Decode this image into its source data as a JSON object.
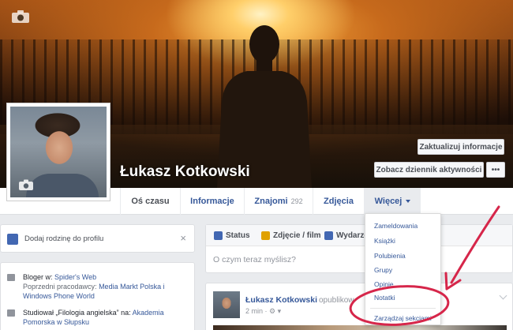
{
  "profile": {
    "name": "Łukasz Kotkowski",
    "update_info_label": "Zaktualizuj informacje",
    "activity_log_label": "Zobacz dziennik aktywności",
    "more_label": "•••"
  },
  "nav": {
    "tabs": [
      {
        "label": "Oś czasu",
        "active": true
      },
      {
        "label": "Informacje"
      },
      {
        "label": "Znajomi",
        "count": "292"
      },
      {
        "label": "Zdjęcia"
      },
      {
        "label": "Więcej"
      }
    ]
  },
  "dropdown": {
    "items": [
      "Zameldowania",
      "Książki",
      "Polubienia",
      "Grupy",
      "Opinie",
      "Notatki"
    ],
    "manage_label": "Zarządzaj sekcjami"
  },
  "family": {
    "label": "Dodaj rodzinę do profilu",
    "close": "×"
  },
  "about": {
    "blogger_prefix": "Bloger w: ",
    "blogger_link": "Spider's Web",
    "prev_prefix": "Poprzedni pracodawcy: ",
    "prev_employers": "Media Markt Polska i Windows Phone World",
    "studied_prefix": "Studiował ",
    "studied_subject": "„Filologia angielska”",
    "studied_at": " na: ",
    "school_link": "Akademia Pomorska w Słupsku"
  },
  "composer": {
    "tabs": [
      "Status",
      "Zdjęcie / film",
      "Wydarzen"
    ],
    "placeholder": "O czym teraz myślisz?"
  },
  "post": {
    "author": "Łukasz Kotkowski",
    "action": "opublikow",
    "time": "2 min · ⚙ ▾"
  },
  "colors": {
    "link": "#365899",
    "annotation": "#d6264a"
  }
}
